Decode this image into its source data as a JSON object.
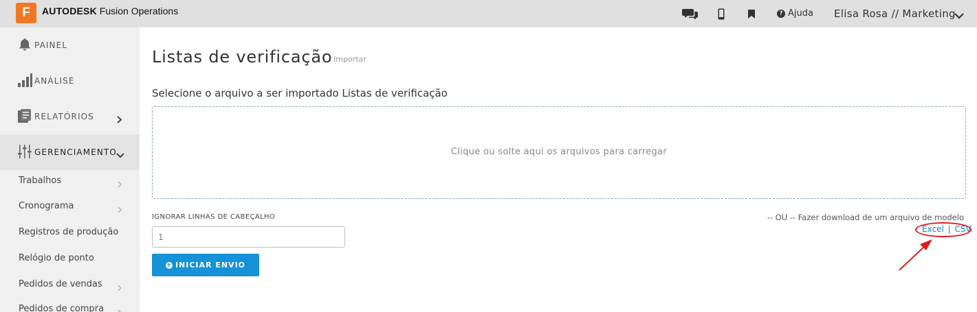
{
  "topbar": {
    "brand_bold": "AUTODESK",
    "brand_rest": "Fusion Operations",
    "logo_letter": "F",
    "help_label": "Ajuda",
    "user_label": "Elisa Rosa // Marketing",
    "icons": [
      "chat-icon",
      "mobile-icon",
      "bookmark-icon",
      "help-icon",
      "chevron-down-icon"
    ]
  },
  "sidebar": {
    "main_items": [
      {
        "label": "PAINEL",
        "icon": "bell-icon"
      },
      {
        "label": "ANÁLISE",
        "icon": "bar-chart-icon"
      },
      {
        "label": "RELATÓRIOS",
        "icon": "report-icon"
      },
      {
        "label": "GERENCIAMENTO",
        "icon": "sliders-icon"
      }
    ],
    "sub_items": [
      {
        "label": "Trabalhos"
      },
      {
        "label": "Cronograma"
      },
      {
        "label": "Registros de produção"
      },
      {
        "label": "Relógio de ponto"
      },
      {
        "label": "Pedidos de vendas"
      },
      {
        "label": "Pedidos de compra"
      }
    ]
  },
  "main": {
    "title": "Listas de verificação",
    "subtitle": "Importar",
    "select_label": "Selecione o arquivo a ser importado Listas de verificação",
    "dropzone_text": "Clique ou solte aqui os arquivos para carregar",
    "ignore_label": "IGNORAR LINHAS DE CABEÇALHO",
    "ignore_value": "1",
    "submit_label": "INICIAR ENVIO",
    "template_text": "-- OU -- Fazer download de um arquivo de modelo",
    "excel_label": "Excel",
    "separator": "|",
    "csv_label": "CSV"
  },
  "colors": {
    "accent": "#1592d8",
    "logo": "#f27623",
    "annotation": "#e01b1b",
    "link": "#1e7dc4"
  }
}
